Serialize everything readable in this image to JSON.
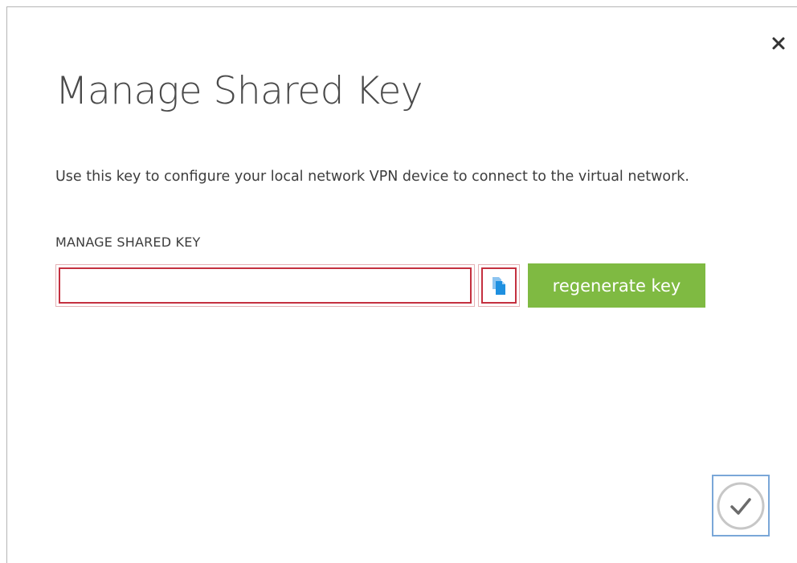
{
  "dialog": {
    "title": "Manage Shared Key",
    "description": "Use this key to configure your local network VPN device to connect to the virtual network.",
    "field_label": "MANAGE SHARED KEY",
    "key_value": "",
    "regenerate_label": "regenerate key",
    "close_icon": "close-icon",
    "copy_icon": "copy-icon",
    "confirm_icon": "checkmark-icon"
  },
  "colors": {
    "accent_green": "#7fba42",
    "error_red": "#c4303f",
    "copy_blue": "#1e90e0",
    "focus_blue": "#7aa7d8",
    "text": "#3d3d3d"
  }
}
